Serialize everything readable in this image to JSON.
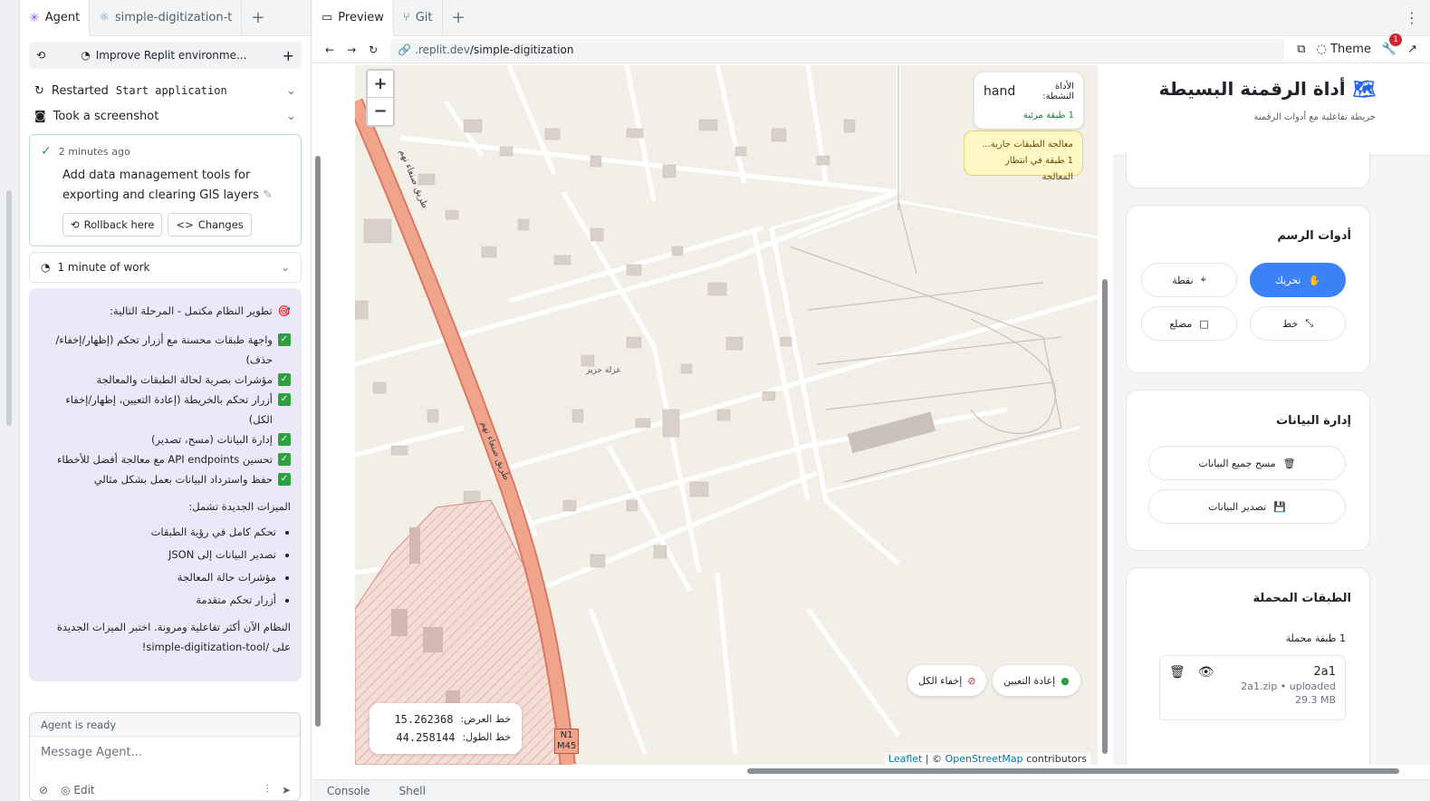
{
  "agent_tabs": {
    "agent": "Agent",
    "project": "simple-digitization-t"
  },
  "agent_toolbar": {
    "title": "Improve Replit environme..."
  },
  "log": [
    {
      "label": "Restarted",
      "mono": "Start application"
    },
    {
      "label": "Took a screenshot",
      "mono": ""
    }
  ],
  "checkpoint": {
    "time": "2 minutes ago",
    "message": "Add data management tools for exporting and clearing GIS layers",
    "rollback": "Rollback here",
    "changes": "Changes"
  },
  "work": "1 minute of work",
  "summary": {
    "heading": "تطوير النظام مكتمل - المرحلة التالية:",
    "checks": [
      "واجهة طبقات محسنة مع أزرار تحكم (إظهار/إخفاء/حذف)",
      "مؤشرات بصرية لحالة الطبقات والمعالجة",
      "أزرار تحكم بالخريطة (إعادة التعيين، إظهار/إخفاء الكل)",
      "إدارة البيانات (مسح، تصدير)",
      "تحسين API endpoints مع معالجة أفضل للأخطاء",
      "حفظ واسترداد البيانات بعمل بشكل مثالي"
    ],
    "features_heading": "الميزات الجديدة تشمل:",
    "features": [
      "تحكم كامل في رؤية الطبقات",
      "تصدير البيانات إلى JSON",
      "مؤشرات حالة المعالجة",
      "أزرار تحكم متقدمة"
    ],
    "closing": "النظام الآن أكثر تفاعلية ومرونة. اختبر الميزات الجديدة على /simple-digitization-tool!"
  },
  "composer": {
    "status": "Agent is ready",
    "placeholder": "Message Agent...",
    "edit": "Edit"
  },
  "workspace_tabs": {
    "preview": "Preview",
    "git": "Git"
  },
  "address": {
    "host": ".replit.dev",
    "path": "/simple-digitization",
    "theme": "Theme",
    "notifications": "1"
  },
  "map": {
    "active_tool_label": "الأداة النشطة:",
    "active_tool": "hand",
    "visible_layers": "1 طبقة مرئية",
    "processing": "معالجة الطبقات جارية...",
    "processing_queue": "1 طبقة في انتظار المعالجة",
    "lat_label": "خط العرض:",
    "lat": "15.262368",
    "lng_label": "خط الطول:",
    "lng": "44.258144",
    "reset": "إعادة التعيين",
    "hide_all": "إخفاء الكل",
    "road_label": "طريق صنعاء نهم",
    "place_label": "عزلة حزيز",
    "road_code_1": "N1",
    "road_code_2": "M45",
    "attrib_leaflet": "Leaflet",
    "attrib_osm": "OpenStreetMap",
    "attrib_tail": "contributors"
  },
  "sidebar": {
    "title": "أداة الرقمنة البسيطة",
    "subtitle": "خريطة تفاعلية مع أدوات الرقمنة",
    "draw_title": "أدوات الرسم",
    "draw_tools": [
      "تحريك",
      "نقطة",
      "خط",
      "مضلع"
    ],
    "data_title": "إدارة البيانات",
    "clear_data": "مسح جميع البيانات",
    "export_data": "تصدير البيانات",
    "layers_title": "الطبقات المحملة",
    "layers_count": "1 طبقة محملة",
    "layer_name": "2a1",
    "layer_meta": "2a1.zip • uploaded",
    "layer_size": "29.3 MB"
  },
  "bottom_tabs": [
    "Console",
    "Shell"
  ]
}
